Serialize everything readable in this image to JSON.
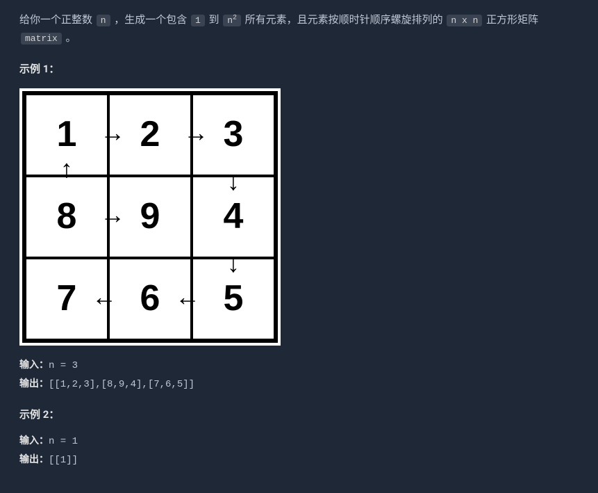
{
  "description": {
    "part1": "给你一个正整数 ",
    "code1": "n",
    "part2": " ，生成一个包含 ",
    "code2": "1",
    "part3": " 到 ",
    "code3_base": "n",
    "code3_sup": "2",
    "part4": " 所有元素，且元素按顺时针顺序螺旋排列的 ",
    "code4": "n x n",
    "part5": " 正方形矩阵 ",
    "code5": "matrix",
    "part6": " 。"
  },
  "example1": {
    "title": "示例 1：",
    "matrix": {
      "cells": [
        "1",
        "2",
        "3",
        "8",
        "9",
        "4",
        "7",
        "6",
        "5"
      ]
    },
    "input_label": "输入：",
    "input_value": "n = 3",
    "output_label": "输出：",
    "output_value": "[[1,2,3],[8,9,4],[7,6,5]]"
  },
  "example2": {
    "title": "示例 2：",
    "input_label": "输入：",
    "input_value": "n = 1",
    "output_label": "输出：",
    "output_value": "[[1]]"
  }
}
